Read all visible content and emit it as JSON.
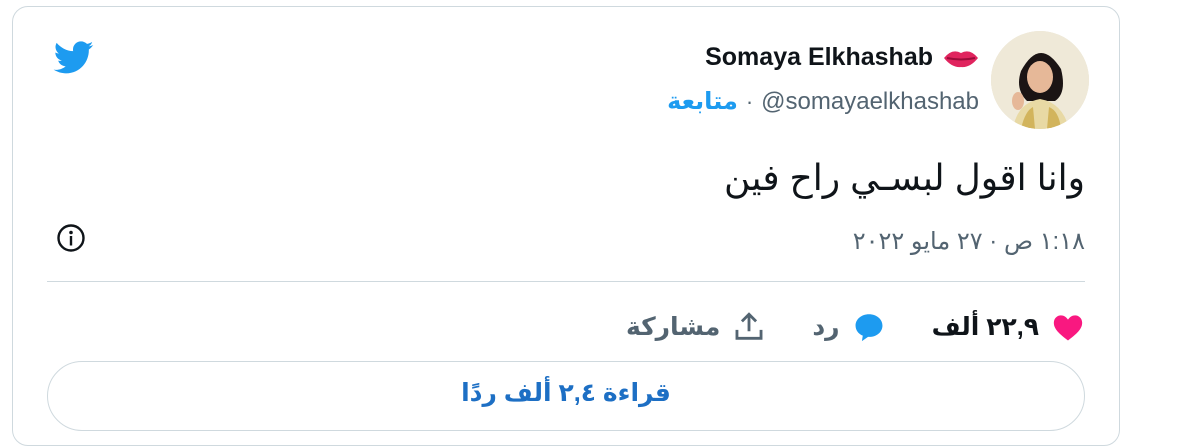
{
  "user": {
    "name": "Somaya Elkhashab",
    "handle": "@somayaelkhashab",
    "follow_label": "متابعة",
    "separator": "·",
    "name_emoji_icon": "lips-icon",
    "avatar_icon": "profile-photo"
  },
  "tweet": {
    "text": "وانا اقول لبسـي راح فين",
    "timestamp": "١:١٨ ص · ٢٧ مايو ٢٠٢٢"
  },
  "actions": {
    "likes": {
      "count": "٢٢,٩ ألف",
      "icon": "heart-icon"
    },
    "reply": {
      "label": "رد",
      "icon": "reply-bubble-icon"
    },
    "share": {
      "label": "مشاركة",
      "icon": "share-upload-icon"
    }
  },
  "read_replies_label": "قراءة ٢,٤ ألف ردًا",
  "colors": {
    "twitter_blue": "#1d9bf0",
    "heart_pink": "#f91880",
    "text_primary": "#0f1419",
    "text_secondary": "#536471",
    "border": "#cfd9de"
  }
}
